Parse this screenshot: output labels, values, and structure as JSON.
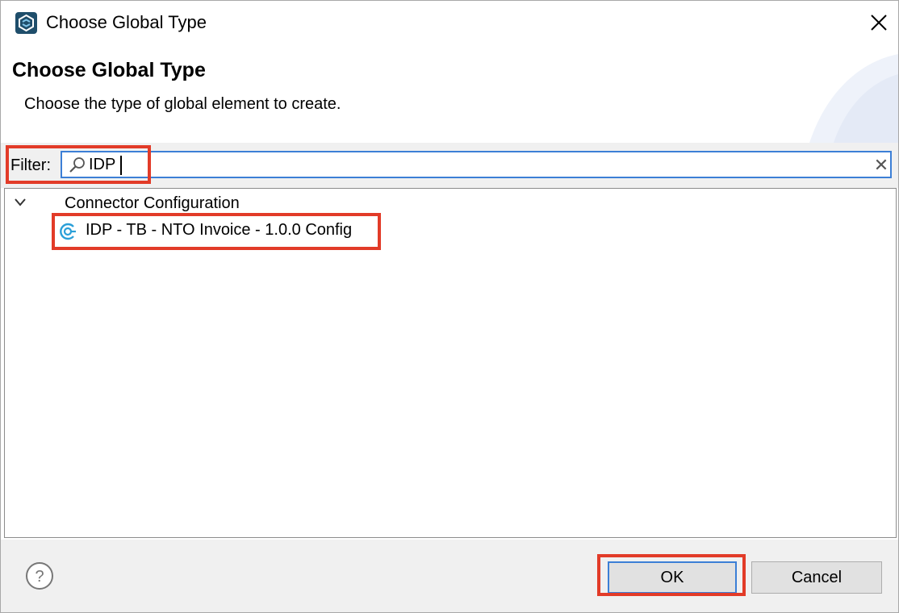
{
  "window": {
    "title": "Choose Global Type",
    "app_icon": "anypoint-studio-icon",
    "close_icon": "close-icon"
  },
  "header": {
    "title": "Choose Global Type",
    "description": "Choose the type of global element to create."
  },
  "filter": {
    "label": "Filter:",
    "value": "IDP",
    "search_icon": "search-icon",
    "clear_symbol": "✕"
  },
  "tree": {
    "group": {
      "label": "Connector Configuration",
      "expanded": true,
      "items": [
        {
          "label": "IDP - TB - NTO Invoice - 1.0.0 Config",
          "icon": "connector-icon"
        }
      ]
    }
  },
  "footer": {
    "help_icon": "help-icon",
    "ok_label": "OK",
    "cancel_label": "Cancel"
  },
  "colors": {
    "highlight": "#e23b28",
    "focus": "#3c7fd6",
    "panel": "#f0f0f0",
    "connector_icon": "#2a9fd8"
  }
}
